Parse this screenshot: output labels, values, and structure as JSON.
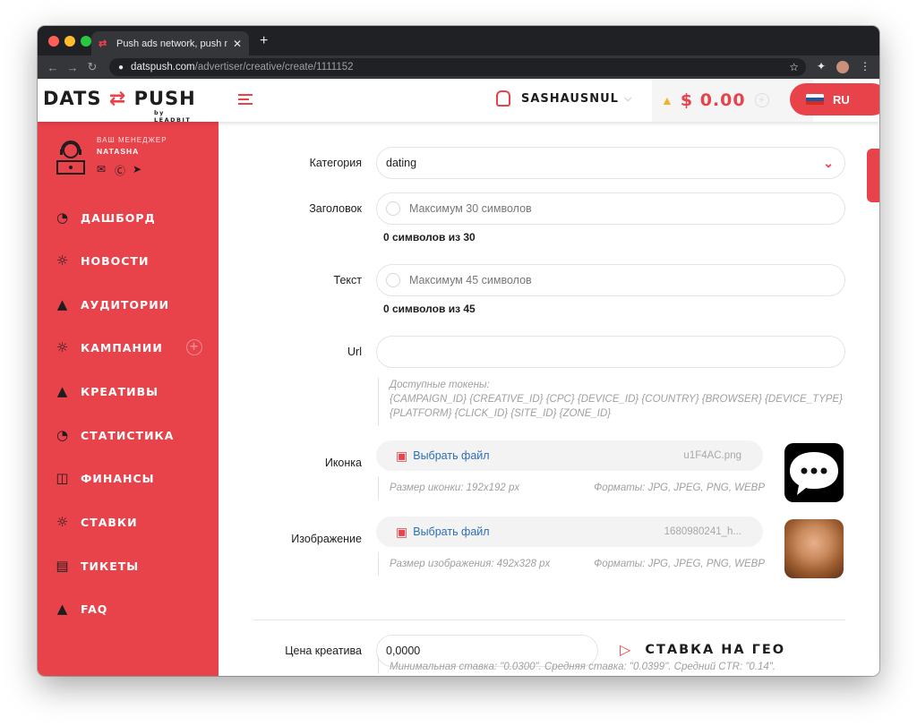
{
  "browser": {
    "tab_title": "Push ads network, push monet",
    "tab_close": "✕",
    "new_tab": "+",
    "url_host": "datspush.com",
    "url_path": "/advertiser/creative/create/1111152"
  },
  "header": {
    "logo_left": "DATS",
    "logo_right": "PUSH",
    "logo_by": "by LEADBIT",
    "username": "SASHAUSNUL",
    "balance": "$ 0.00",
    "language": "RU"
  },
  "manager": {
    "label": "ВАШ МЕНЕДЖЕР",
    "name": "NATASHA"
  },
  "sidebar": {
    "items": [
      {
        "label": "ДАШБОРД"
      },
      {
        "label": "НОВОСТИ"
      },
      {
        "label": "АУДИТОРИИ"
      },
      {
        "label": "КАМПАНИИ"
      },
      {
        "label": "КРЕАТИВЫ"
      },
      {
        "label": "СТАТИСТИКА"
      },
      {
        "label": "ФИНАНСЫ"
      },
      {
        "label": "СТАВКИ"
      },
      {
        "label": "ТИКЕТЫ"
      },
      {
        "label": "FAQ"
      }
    ]
  },
  "form": {
    "category_label": "Категория",
    "category_value": "dating",
    "title_label": "Заголовок",
    "title_placeholder": "Максимум 30 символов",
    "title_counter": "0 символов из 30",
    "text_label": "Текст",
    "text_placeholder": "Максимум 45 символов",
    "text_counter": "0 символов из 45",
    "url_label": "Url",
    "url_value": "",
    "tokens_title": "Доступные токены:",
    "tokens_line1": "{CAMPAIGN_ID} {CREATIVE_ID} {CPC} {DEVICE_ID} {COUNTRY} {BROWSER} {DEVICE_TYPE}",
    "tokens_line2": "{PLATFORM} {CLICK_ID} {SITE_ID} {ZONE_ID}",
    "icon_label": "Иконка",
    "icon_pick": "Выбрать файл",
    "icon_filename": "u1F4AC.png",
    "icon_size_hint": "Размер иконки: 192x192 px",
    "icon_formats": "Форматы: JPG, JPEG, PNG, WEBP",
    "image_label": "Изображение",
    "image_pick": "Выбрать файл",
    "image_filename": "1680980241_h...",
    "image_size_hint": "Размер изображения: 492x328 px",
    "image_formats": "Форматы: JPG, JPEG, PNG, WEBP",
    "price_label": "Цена креатива",
    "price_value": "0,0000",
    "geo_bid": "СТАВКА НА ГЕО",
    "price_hint": "Минимальная ставка: \"0.0300\". Средняя ставка: \"0.0399\". Средний CTR: \"0.14\"."
  },
  "colors": {
    "accent": "#e8424b",
    "link": "#2b6fb7",
    "warning": "#f0b429"
  }
}
